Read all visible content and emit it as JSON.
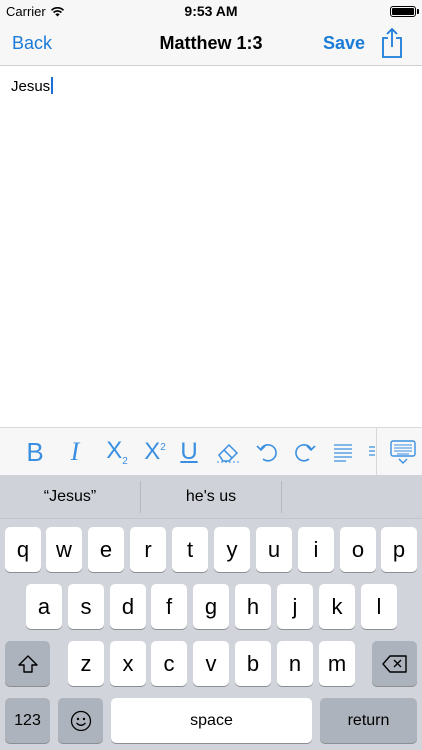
{
  "status_bar": {
    "carrier": "Carrier",
    "time": "9:53 AM",
    "battery_level": 1.0
  },
  "nav_bar": {
    "back_label": "Back",
    "title": "Matthew 1:3",
    "save_label": "Save",
    "share_icon": "share-icon"
  },
  "editor": {
    "text": "Jesus"
  },
  "toolbar": {
    "bold_label": "B",
    "italic_label": "I",
    "subscript_label": "X",
    "subscript_mark": "2",
    "superscript_label": "X",
    "superscript_mark": "2",
    "underline_label": "U",
    "icons": [
      "bold-icon",
      "italic-icon",
      "subscript-icon",
      "superscript-icon",
      "underline-icon",
      "eraser-icon",
      "undo-icon",
      "redo-icon",
      "align-icon",
      "keyboard-dismiss-icon"
    ]
  },
  "keyboard": {
    "suggestions": [
      "“Jesus”",
      "he's us",
      ""
    ],
    "row1": [
      "q",
      "w",
      "e",
      "r",
      "t",
      "y",
      "u",
      "i",
      "o",
      "p"
    ],
    "row2": [
      "a",
      "s",
      "d",
      "f",
      "g",
      "h",
      "j",
      "k",
      "l"
    ],
    "row3": [
      "z",
      "x",
      "c",
      "v",
      "b",
      "n",
      "m"
    ],
    "numbers_label": "123",
    "space_label": "space",
    "return_label": "return"
  },
  "colors": {
    "accent": "#1b7cd8",
    "toolbar_icon": "#3a8fe0",
    "keyboard_bg": "#d1d5db",
    "key_dark": "#adb3bc"
  }
}
